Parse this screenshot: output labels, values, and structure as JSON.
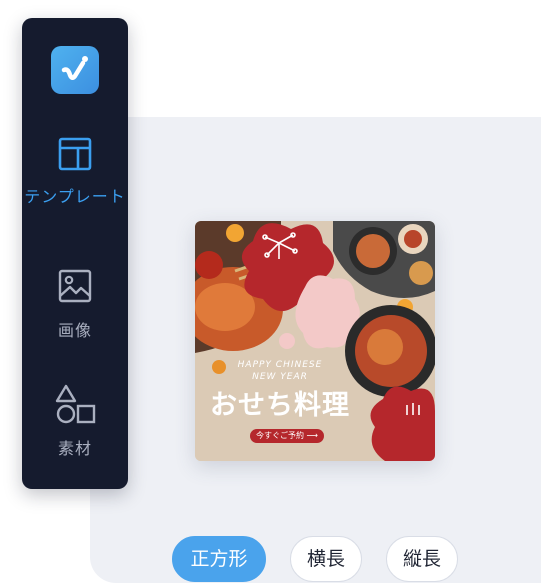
{
  "sidebar": {
    "logo_icon": "brand-logo-icon",
    "items": [
      {
        "label": "テンプレート",
        "icon": "template-layout-icon",
        "active": true
      },
      {
        "label": "画像",
        "icon": "image-icon",
        "active": false
      },
      {
        "label": "素材",
        "icon": "shapes-icon",
        "active": false
      }
    ]
  },
  "preview": {
    "headline_small_line1": "HAPPY CHINESE",
    "headline_small_line2": "NEW YEAR",
    "headline_main": "おせち料理",
    "cta": "今すぐご予約 ⟶"
  },
  "formats": {
    "options": [
      "正方形",
      "横長",
      "縦長"
    ],
    "selected": "正方形"
  },
  "colors": {
    "accent": "#4aa3ec",
    "sidebar_bg": "#151b2e",
    "canvas_bg": "#eef0f5",
    "preview_red": "#b5272c"
  }
}
